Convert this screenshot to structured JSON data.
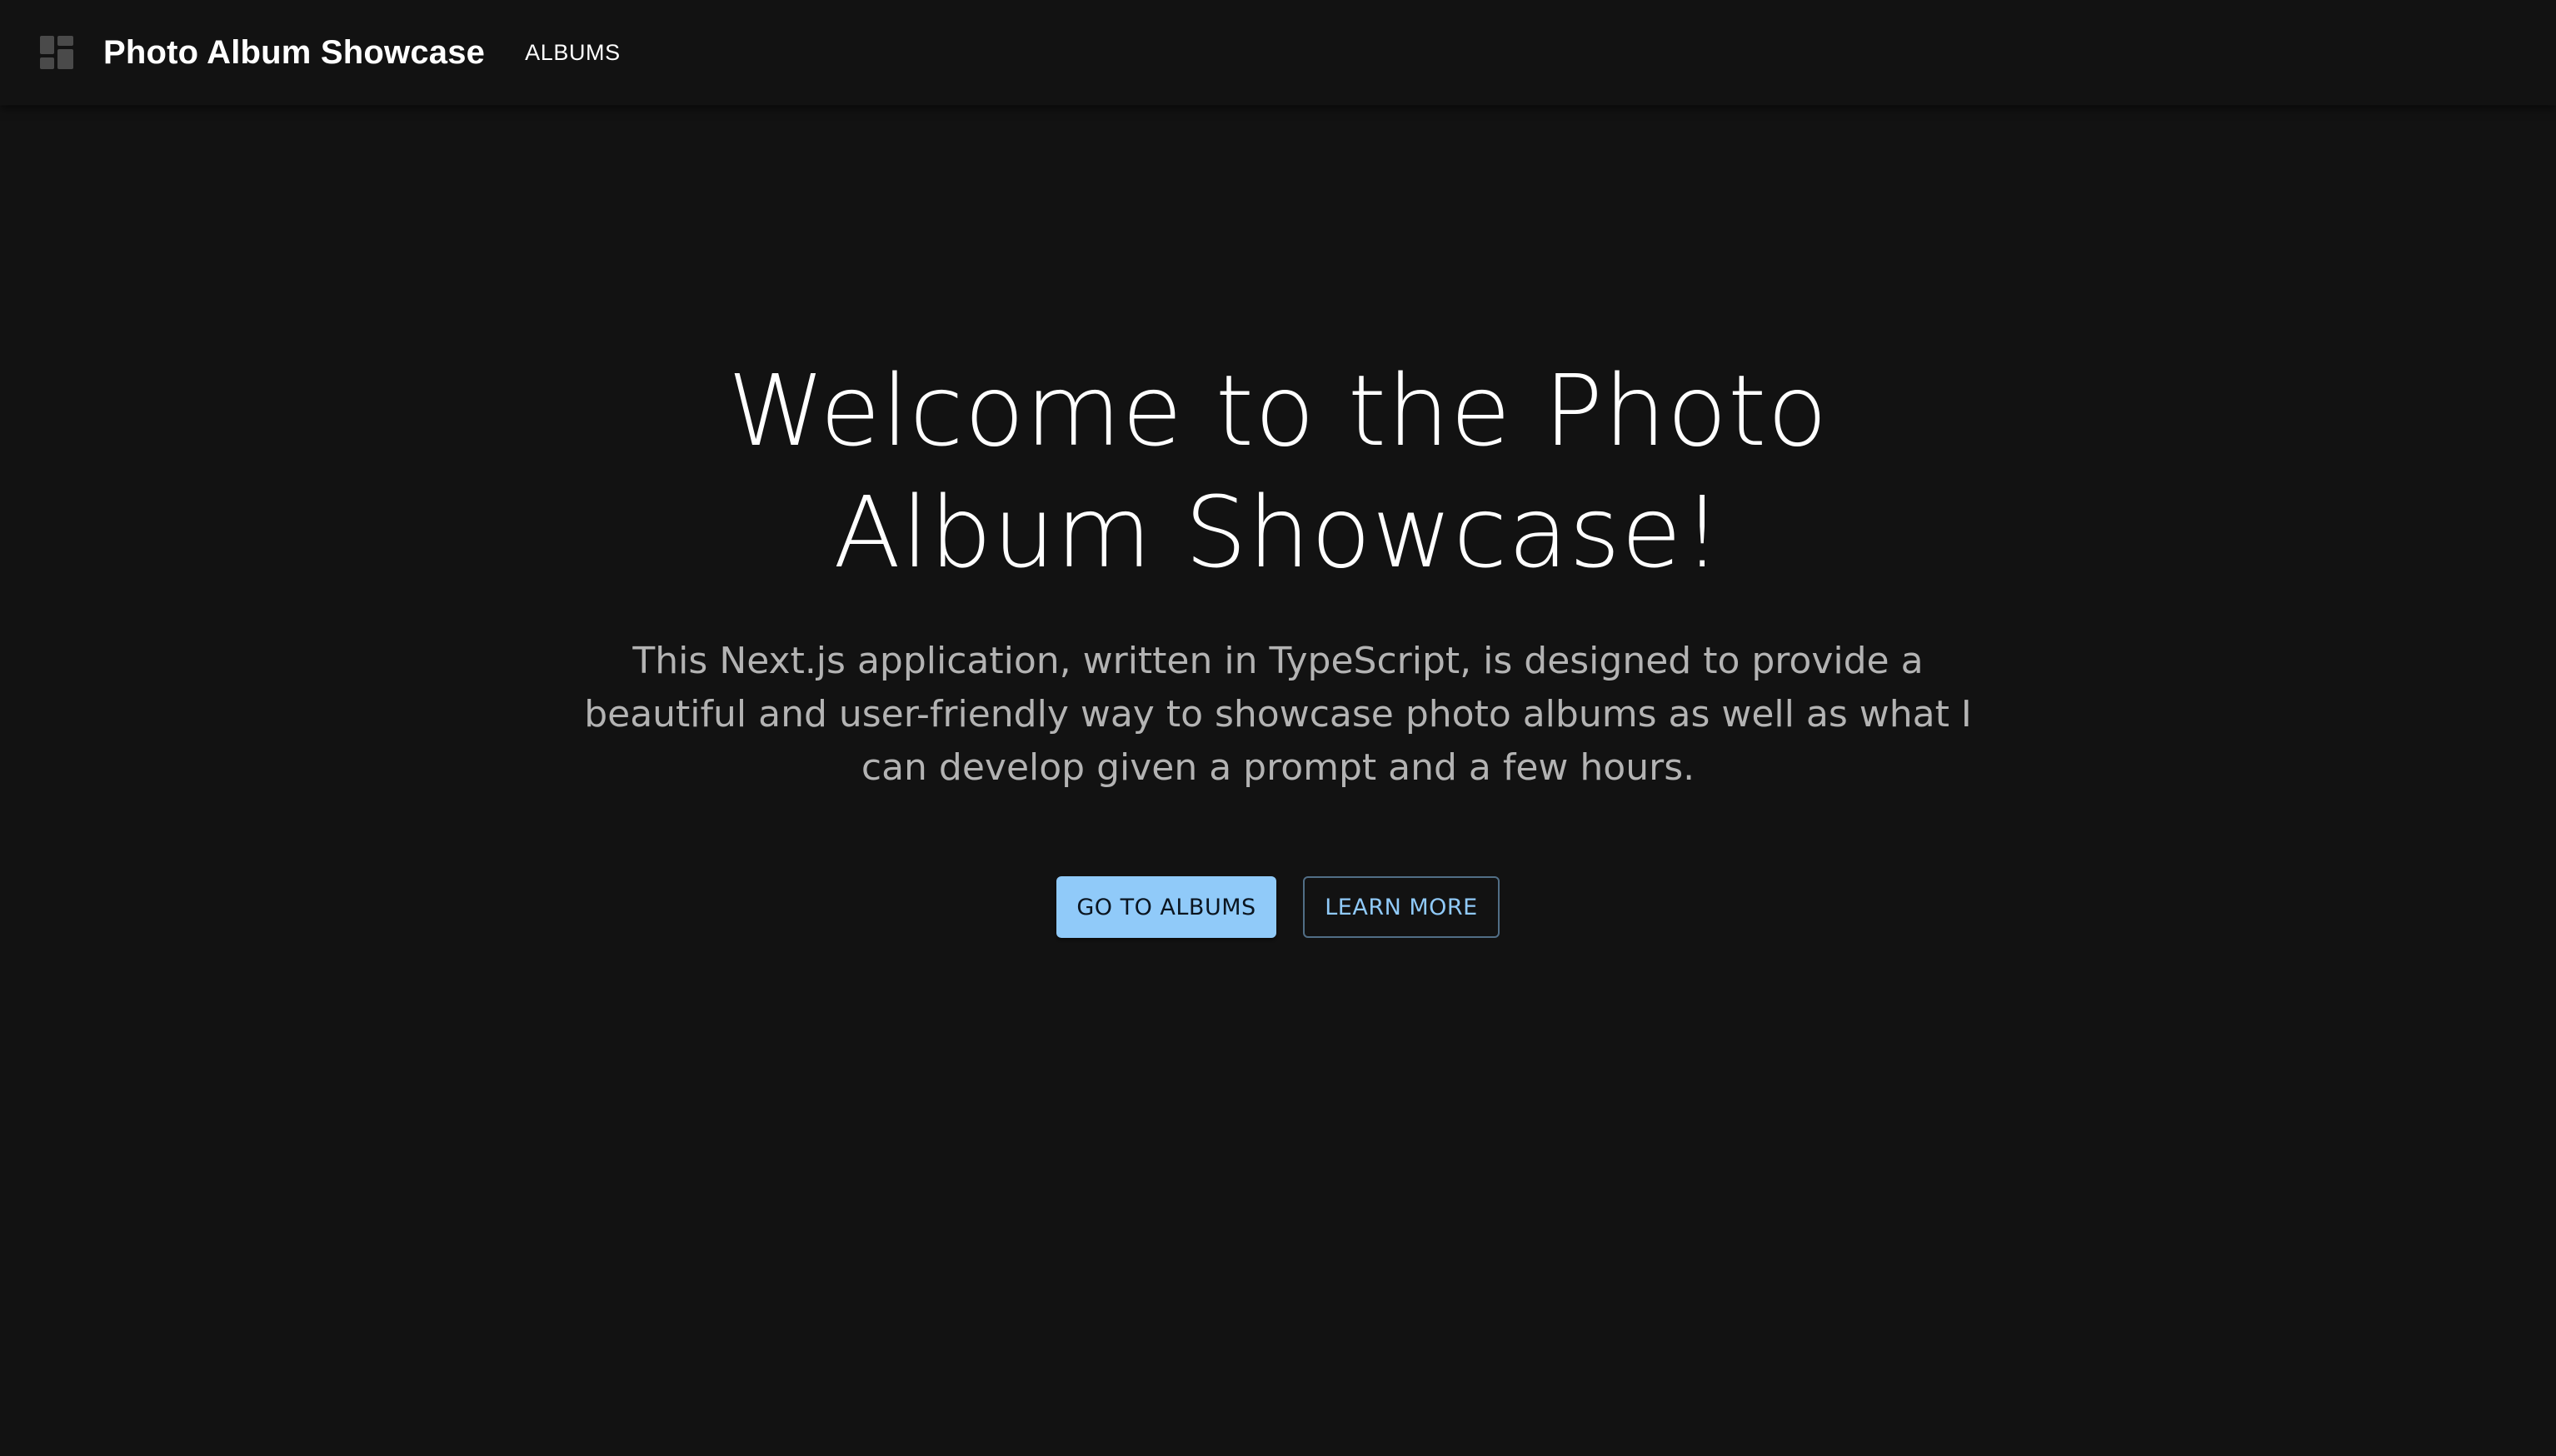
{
  "appbar": {
    "logo_icon": "dashboard-grid-icon",
    "title": "Photo Album Showcase",
    "nav": [
      {
        "label": "ALBUMS"
      }
    ]
  },
  "hero": {
    "title": "Welcome to the Photo Album Showcase!",
    "subtitle": "This Next.js application, written in TypeScript, is designed to provide a beautiful and user-friendly way to showcase photo albums as well as what I can develop given a prompt and a few hours.",
    "primary_button": "GO TO ALBUMS",
    "secondary_button": "LEARN MORE"
  },
  "colors": {
    "background": "#121212",
    "accent": "#90caf9",
    "text_primary": "#ffffff",
    "text_secondary": "#b3b3b3"
  }
}
